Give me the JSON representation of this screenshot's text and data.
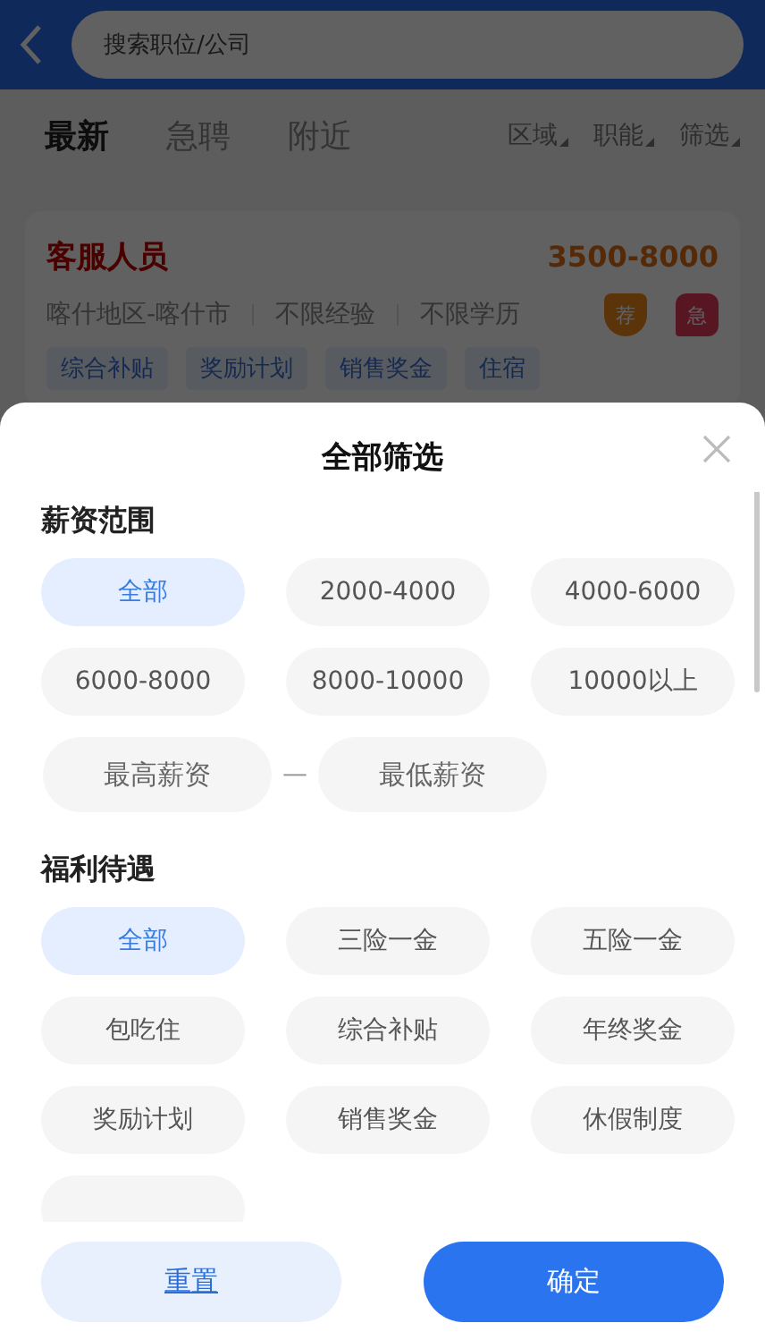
{
  "header": {
    "search": {
      "placeholder": "搜索职位/公司"
    }
  },
  "tabs": [
    {
      "label": "最新",
      "selected": true
    },
    {
      "label": "急聘",
      "selected": false
    },
    {
      "label": "附近",
      "selected": false
    }
  ],
  "dropdowns": [
    {
      "label": "区域"
    },
    {
      "label": "职能"
    },
    {
      "label": "筛选"
    }
  ],
  "job_card": {
    "title": "客服人员",
    "salary": "3500-8000",
    "meta": [
      "喀什地区-喀什市",
      "不限经验",
      "不限学历"
    ],
    "badges": [
      {
        "kind": "shield",
        "label": "荐"
      },
      {
        "kind": "urgent",
        "label": "急"
      }
    ],
    "tags": [
      "综合补贴",
      "奖励计划",
      "销售奖金",
      "住宿"
    ]
  },
  "filter_sheet": {
    "title": "全部筛选",
    "sections": [
      {
        "title": "薪资范围",
        "options": [
          {
            "label": "全部",
            "selected": true
          },
          {
            "label": "2000-4000",
            "selected": false
          },
          {
            "label": "4000-6000",
            "selected": false
          },
          {
            "label": "6000-8000",
            "selected": false
          },
          {
            "label": "8000-10000",
            "selected": false
          },
          {
            "label": "10000以上",
            "selected": false
          }
        ],
        "range": {
          "min_placeholder": "最高薪资",
          "separator": "—",
          "max_placeholder": "最低薪资"
        }
      },
      {
        "title": "福利待遇",
        "options": [
          {
            "label": "全部",
            "selected": true
          },
          {
            "label": "三险一金",
            "selected": false
          },
          {
            "label": "五险一金",
            "selected": false
          },
          {
            "label": "包吃住",
            "selected": false
          },
          {
            "label": "综合补贴",
            "selected": false
          },
          {
            "label": "年终奖金",
            "selected": false
          },
          {
            "label": "奖励计划",
            "selected": false
          },
          {
            "label": "销售奖金",
            "selected": false
          },
          {
            "label": "休假制度",
            "selected": false
          },
          {
            "selected": false
          }
        ]
      }
    ],
    "buttons": [
      {
        "kind": "secondary",
        "label": "重置"
      },
      {
        "kind": "primary",
        "label": "确定"
      }
    ]
  }
}
